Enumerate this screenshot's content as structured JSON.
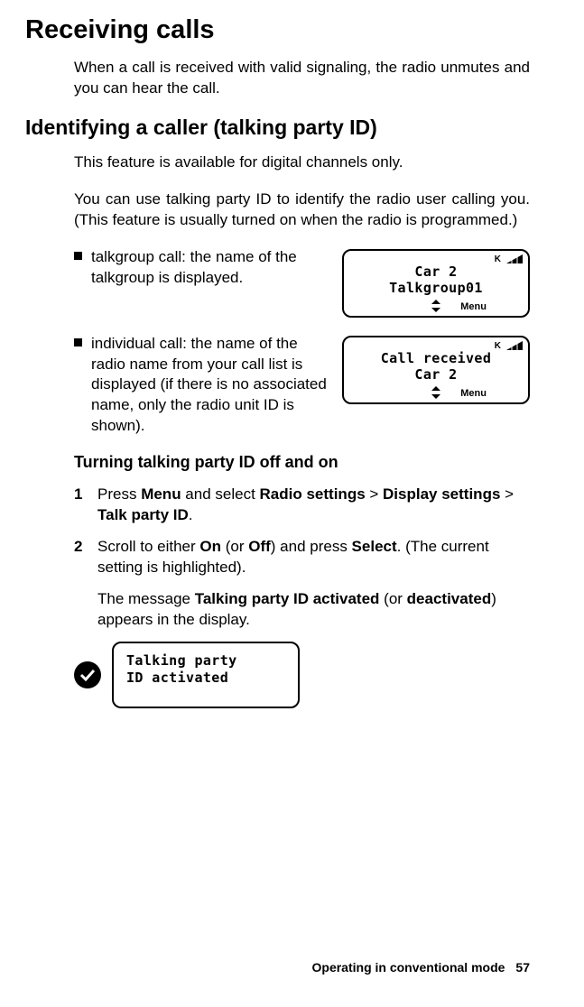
{
  "title": "Receiving calls",
  "intro": "When a call is received with valid signaling, the radio unmutes and you can hear the call.",
  "section1": {
    "heading": "Identifying a caller (talking party ID)",
    "para1": "This feature is available for digital channels only.",
    "para2": "You can use talking party ID to identify the radio user calling you. (This feature is usually turned on when the radio is programmed.)",
    "bullet1": "talkgroup call: the name of the talkgroup is dis­played.",
    "bullet2": "individual call: the name of the radio name from your call list is displayed (if there is no associated name, only the radio unit ID is shown)."
  },
  "screen1": {
    "line1": "Car 2",
    "line2": "Talkgroup01",
    "menu": "Menu"
  },
  "screen2": {
    "line1": "Call received",
    "line2": "Car 2",
    "menu": "Menu"
  },
  "sub": {
    "heading": "Turning talking party ID off and on",
    "step1_num": "1",
    "step1_a": "Press ",
    "step1_b": "Menu",
    "step1_c": " and select ",
    "step1_d": "Radio settings",
    "step1_e": " > ",
    "step1_f": "Display settings",
    "step1_g": " > ",
    "step1_h": "Talk party ID",
    "step1_i": ".",
    "step2_num": "2",
    "step2_a": "Scroll to either ",
    "step2_b": "On",
    "step2_c": " (or ",
    "step2_d": "Off",
    "step2_e": ") and press ",
    "step2_f": "Select",
    "step2_g": ". (The current setting is highlighted).",
    "result_a": "The message ",
    "result_b": "Talking party ID activated",
    "result_c": " (or ",
    "result_d": "deactivated",
    "result_e": ") appears in the display."
  },
  "screen3": {
    "line1": "Talking party",
    "line2": "ID activated"
  },
  "footer": {
    "label": "Operating in conventional mode",
    "page": "57"
  }
}
